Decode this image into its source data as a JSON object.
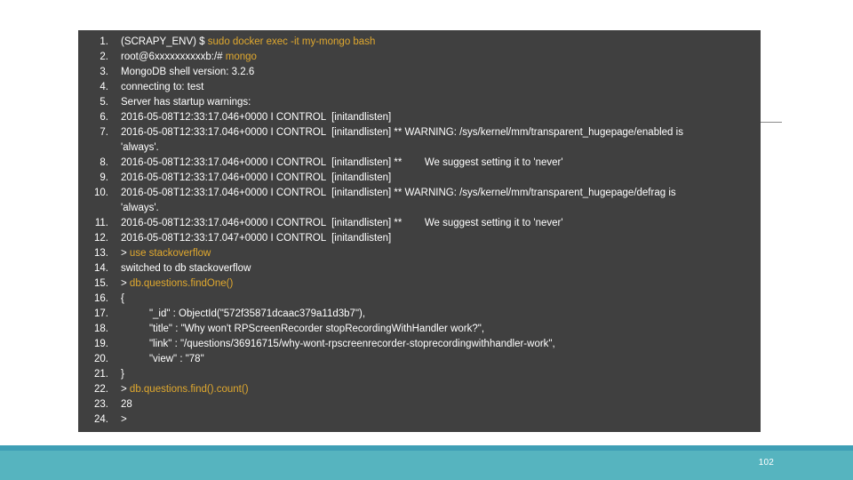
{
  "slide": {
    "page_number": "102",
    "accent_color": "#e0a82e",
    "terminal_bg": "#404040",
    "footer_color": "#56b4bf",
    "footer_accent_color": "#3f9fb5",
    "text_color": "#ffffff"
  },
  "terminal": {
    "lines": [
      {
        "number": "1.",
        "segments": [
          {
            "text": "(SCRAPY_ENV) $ ",
            "color": "white"
          },
          {
            "text": "sudo docker exec -it my-mongo bash",
            "color": "amber"
          }
        ]
      },
      {
        "number": "2.",
        "segments": [
          {
            "text": "root@6xxxxxxxxxxb:/# ",
            "color": "white"
          },
          {
            "text": "mongo",
            "color": "amber"
          }
        ]
      },
      {
        "number": "3.",
        "segments": [
          {
            "text": "MongoDB shell version: 3.2.6",
            "color": "white"
          }
        ]
      },
      {
        "number": "4.",
        "segments": [
          {
            "text": "connecting to: test",
            "color": "white"
          }
        ]
      },
      {
        "number": "5.",
        "segments": [
          {
            "text": "Server has startup warnings:",
            "color": "white"
          }
        ]
      },
      {
        "number": "6.",
        "segments": [
          {
            "text": "2016-05-08T12:33:17.046+0000 I CONTROL  [initandlisten]",
            "color": "white"
          }
        ]
      },
      {
        "number": "7.",
        "segments": [
          {
            "text": "2016-05-08T12:33:17.046+0000 I CONTROL  [initandlisten] ** WARNING: /sys/kernel/mm/transparent_hugepage/enabled is",
            "color": "white"
          }
        ]
      },
      {
        "number": "",
        "continuation": true,
        "segments": [
          {
            "text": "'always'.",
            "color": "white"
          }
        ]
      },
      {
        "number": "8.",
        "segments": [
          {
            "text": "2016-05-08T12:33:17.046+0000 I CONTROL  [initandlisten] **        We suggest setting it to 'never'",
            "color": "white"
          }
        ]
      },
      {
        "number": "9.",
        "segments": [
          {
            "text": "2016-05-08T12:33:17.046+0000 I CONTROL  [initandlisten]",
            "color": "white"
          }
        ]
      },
      {
        "number": "10.",
        "segments": [
          {
            "text": "2016-05-08T12:33:17.046+0000 I CONTROL  [initandlisten] ** WARNING: /sys/kernel/mm/transparent_hugepage/defrag is",
            "color": "white"
          }
        ]
      },
      {
        "number": "",
        "continuation": true,
        "segments": [
          {
            "text": "'always'.",
            "color": "white"
          }
        ]
      },
      {
        "number": "11.",
        "segments": [
          {
            "text": "2016-05-08T12:33:17.046+0000 I CONTROL  [initandlisten] **        We suggest setting it to 'never'",
            "color": "white"
          }
        ]
      },
      {
        "number": "12.",
        "segments": [
          {
            "text": "2016-05-08T12:33:17.047+0000 I CONTROL  [initandlisten]",
            "color": "white"
          }
        ]
      },
      {
        "number": "13.",
        "segments": [
          {
            "text": "> ",
            "color": "white"
          },
          {
            "text": "use stackoverflow",
            "color": "amber"
          }
        ]
      },
      {
        "number": "14.",
        "segments": [
          {
            "text": "switched to db stackoverflow",
            "color": "white"
          }
        ]
      },
      {
        "number": "15.",
        "segments": [
          {
            "text": "> ",
            "color": "white"
          },
          {
            "text": "db.questions.findOne()",
            "color": "amber"
          }
        ]
      },
      {
        "number": "16.",
        "segments": [
          {
            "text": "{",
            "color": "white"
          }
        ]
      },
      {
        "number": "17.",
        "segments": [
          {
            "text": "          \"_id\" : ObjectId(\"572f35871dcaac379a11d3b7\"),",
            "color": "white"
          }
        ]
      },
      {
        "number": "18.",
        "segments": [
          {
            "text": "          \"title\" : \"Why won't RPScreenRecorder stopRecordingWithHandler work?\",",
            "color": "white"
          }
        ]
      },
      {
        "number": "19.",
        "segments": [
          {
            "text": "          \"link\" : \"/questions/36916715/why-wont-rpscreenrecorder-stoprecordingwithhandler-work\",",
            "color": "white"
          }
        ]
      },
      {
        "number": "20.",
        "segments": [
          {
            "text": "          \"view\" : \"78\"",
            "color": "white"
          }
        ]
      },
      {
        "number": "21.",
        "segments": [
          {
            "text": "}",
            "color": "white"
          }
        ]
      },
      {
        "number": "22.",
        "segments": [
          {
            "text": "> ",
            "color": "white"
          },
          {
            "text": "db.questions.find().count()",
            "color": "amber"
          }
        ]
      },
      {
        "number": "23.",
        "segments": [
          {
            "text": "28",
            "color": "white"
          }
        ]
      },
      {
        "number": "24.",
        "segments": [
          {
            "text": ">",
            "color": "white"
          }
        ]
      }
    ]
  }
}
